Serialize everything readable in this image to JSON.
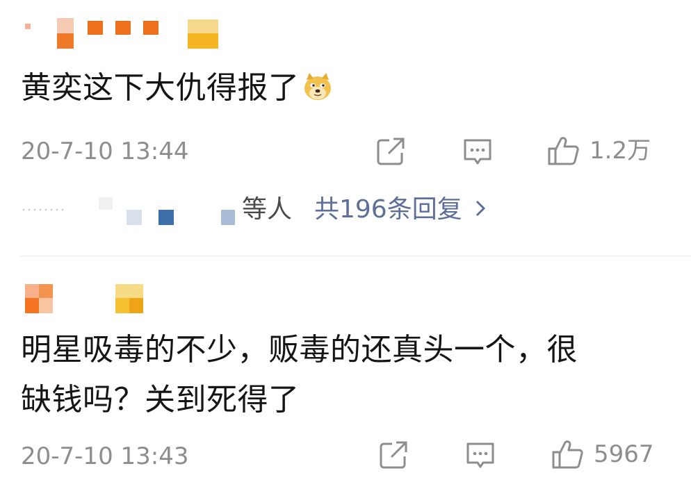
{
  "comments": [
    {
      "text": "黄奕这下大仇得报了",
      "emoji": "doge-emoji-icon",
      "time": "20-7-10 13:44",
      "likes": "1.2万",
      "replies": {
        "deng_label": "等人",
        "link_label": "共196条回复"
      }
    },
    {
      "text_line1": "明星吸毒的不少，贩毒的还真头一个，很",
      "text_line2": "缺钱吗？关到死得了",
      "time": "20-7-10 13:43",
      "likes": "5967"
    }
  ],
  "icons": [
    "share-icon",
    "comment-icon",
    "like-icon",
    "chevron-right-icon"
  ],
  "colors": {
    "text": "#151515",
    "meta": "#8d8d8d",
    "link": "#5d6f96",
    "mosaic_orange": "#f07820",
    "mosaic_yellow": "#f7c545",
    "mosaic_blue": "#3d6fa8"
  }
}
